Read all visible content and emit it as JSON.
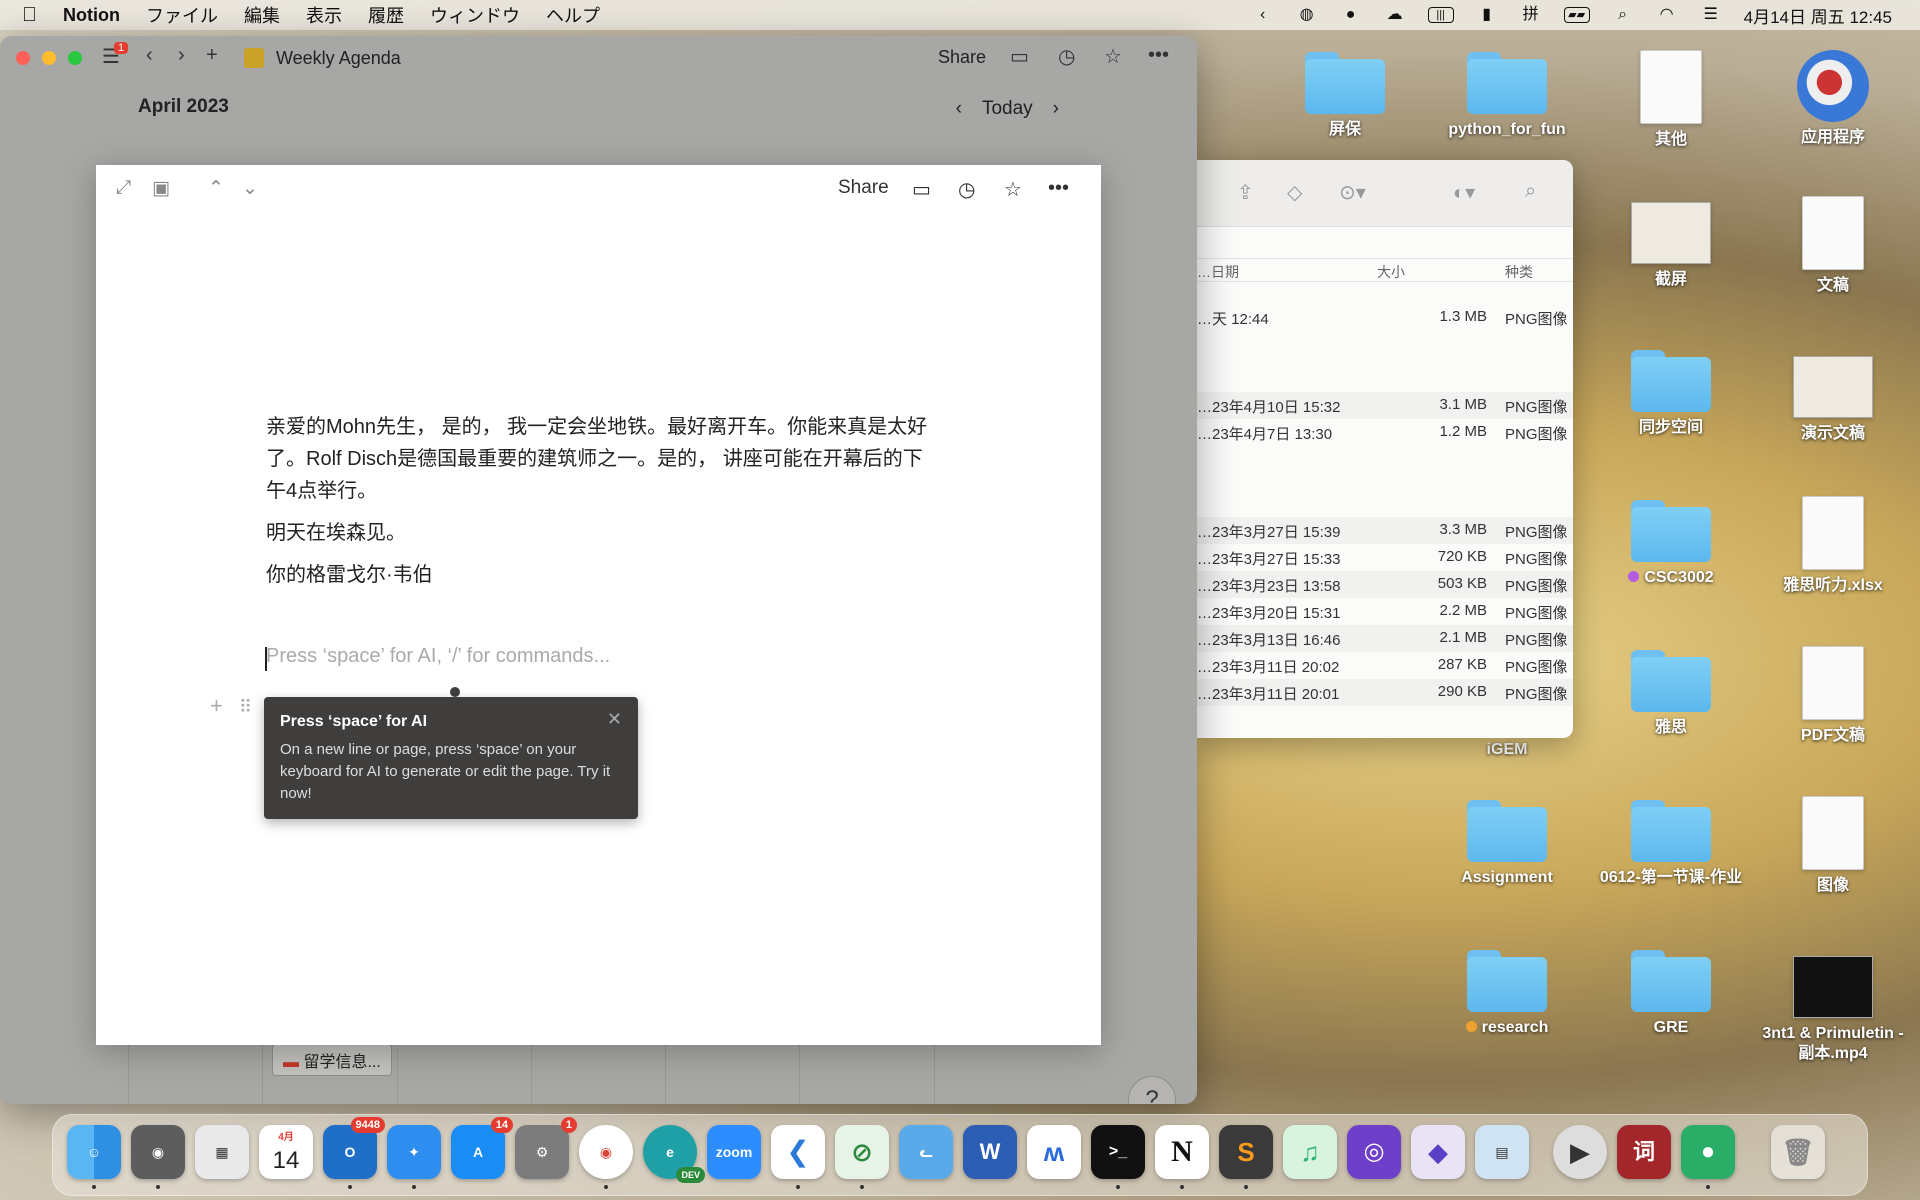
{
  "menubar": {
    "app_name": "Notion",
    "menus": [
      "ファイル",
      "編集",
      "表示",
      "履歴",
      "ウィンドウ",
      "ヘルプ"
    ],
    "clock": "4月14日 周五 12:45",
    "status_icons": [
      "chevron-left-icon",
      "browser-icon",
      "wechat-icon",
      "cloud-icon",
      "battery-saver-icon",
      "person-icon",
      "input-method-icon",
      "battery-icon",
      "search-icon",
      "wifi-icon",
      "control-center-icon"
    ],
    "input_method": "拼"
  },
  "notion": {
    "breadcrumb": "Weekly Agenda",
    "sidebar_badge": "1",
    "share_label": "Share",
    "calendar": {
      "month": "April 2023",
      "today_label": "Today",
      "chip_label": "留学信息..."
    },
    "help_label": "?",
    "peek": {
      "share_label": "Share",
      "paragraphs": [
        "亲爱的Mohn先生， 是的， 我一定会坐地铁。最好离开车。你能来真是太好了。Rolf Disch是德国最重要的建筑师之一。是的， 讲座可能在开幕后的下午4点举行。",
        "明天在埃森见。",
        "你的格雷戈尔·韦伯"
      ],
      "placeholder": "Press ‘space’ for AI, ‘/’ for commands...",
      "tooltip": {
        "title": "Press ‘space’ for AI",
        "body": "On a new line or page, press ‘space’ on your keyboard for AI to generate or edit the page. Try it now!"
      }
    }
  },
  "finder": {
    "columns": [
      "…日期",
      "大小",
      "种类"
    ],
    "rows": [
      {
        "date": "…天 12:44",
        "size": "1.3 MB",
        "kind": "PNG图像"
      },
      {
        "date": "…23年4月10日 15:32",
        "size": "3.1 MB",
        "kind": "PNG图像"
      },
      {
        "date": "…23年4月7日 13:30",
        "size": "1.2 MB",
        "kind": "PNG图像"
      },
      {
        "date": "…23年3月27日 15:39",
        "size": "3.3 MB",
        "kind": "PNG图像"
      },
      {
        "date": "…23年3月27日 15:33",
        "size": "720 KB",
        "kind": "PNG图像"
      },
      {
        "date": "…23年3月23日 13:58",
        "size": "503 KB",
        "kind": "PNG图像"
      },
      {
        "date": "…23年3月20日 15:31",
        "size": "2.2 MB",
        "kind": "PNG图像"
      },
      {
        "date": "…23年3月13日 16:46",
        "size": "2.1 MB",
        "kind": "PNG图像"
      },
      {
        "date": "…23年3月11日 20:02",
        "size": "287 KB",
        "kind": "PNG图像"
      },
      {
        "date": "…23年3月11日 20:01",
        "size": "290 KB",
        "kind": "PNG图像"
      }
    ]
  },
  "desktop": {
    "icons": [
      {
        "label": "屏保",
        "type": "folder"
      },
      {
        "label": "python_for_fun",
        "type": "folder"
      },
      {
        "label": "其他",
        "type": "document"
      },
      {
        "label": "应用程序",
        "type": "app"
      },
      {
        "label": "截屏",
        "type": "screenshot"
      },
      {
        "label": "文稿",
        "type": "document"
      },
      {
        "label": "同步空间",
        "type": "folder"
      },
      {
        "label": "演示文稿",
        "type": "screenshot"
      },
      {
        "label": "CSC3002",
        "type": "folder",
        "tag_color": "#b45de0"
      },
      {
        "label": "雅思听力.xlsx",
        "type": "document"
      },
      {
        "label": "iGEM",
        "type": "folder"
      },
      {
        "label": "雅思",
        "type": "folder"
      },
      {
        "label": "PDF文稿",
        "type": "document"
      },
      {
        "label": "Assignment",
        "type": "folder"
      },
      {
        "label": "0612-第一节课-作业",
        "type": "folder"
      },
      {
        "label": "图像",
        "type": "document"
      },
      {
        "label": "research",
        "type": "folder",
        "tag_color": "#f0a030"
      },
      {
        "label": "GRE",
        "type": "folder"
      },
      {
        "label": "3nt1 & Primuletin - 副本.mp4",
        "type": "video"
      }
    ]
  },
  "dock": {
    "calendar_month": "4月",
    "calendar_day": "14",
    "outlook_badge": "9448",
    "appstore_badge": "14",
    "settings_badge": "1",
    "zoom_label": "zoom",
    "word_label": "W",
    "notion_label": "N",
    "dict_label": "词",
    "edge_dev_label": "DEV"
  },
  "colors": {
    "folder_blue": "#6ec6f4",
    "tooltip_bg": "#3f3e3c",
    "badge_red": "#e43c30"
  }
}
